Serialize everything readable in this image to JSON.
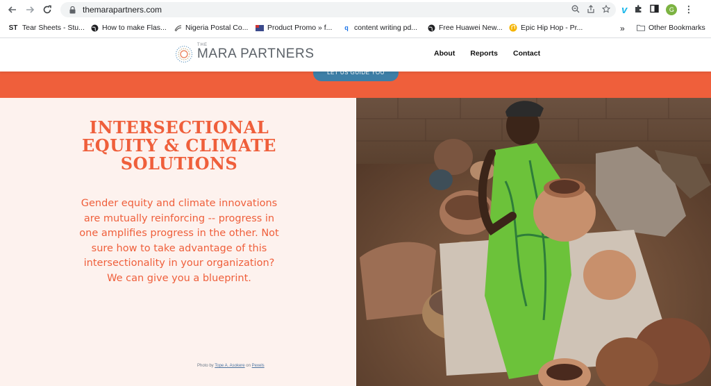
{
  "browser": {
    "url": "themarapartners.com",
    "bookmarks": [
      {
        "label": "Tear Sheets - Stu...",
        "icon": "st-logo"
      },
      {
        "label": "How to make Flas...",
        "icon": "globe-icon"
      },
      {
        "label": "Nigeria Postal Co...",
        "icon": "swirl-icon"
      },
      {
        "label": "Product Promo » f...",
        "icon": "flag-icon"
      },
      {
        "label": "content writing pd...",
        "icon": "search-q-icon"
      },
      {
        "label": "Free Huawei New...",
        "icon": "globe-icon"
      },
      {
        "label": "Epic Hip Hop - Pr...",
        "icon": "music-icon"
      }
    ],
    "bookmarks_overflow": "»",
    "other_bookmarks": "Other Bookmarks",
    "st_label": "ST",
    "profile_initial": "G"
  },
  "site": {
    "logo_the": "THE",
    "logo_name": "MARA PARTNERS",
    "nav": [
      "About",
      "Reports",
      "Contact"
    ],
    "cta": "LET US GUIDE YOU"
  },
  "hero": {
    "headline": "INTERSECTIONAL EQUITY & CLIMATE SOLUTIONS",
    "body": "Gender equity and climate innovations are mutually reinforcing -- progress in one amplifies progress in the other. Not sure how to take advantage of this intersectionality in your organization? We can give you a blueprint.",
    "credit_prefix": "Photo by",
    "credit_author": "Tope A. Asokere",
    "credit_mid": "on",
    "credit_site": "Pexels"
  },
  "colors": {
    "accent": "#ef5f3b",
    "cta_blue": "#3d7ea6",
    "panel_bg": "#fdf2ee"
  }
}
